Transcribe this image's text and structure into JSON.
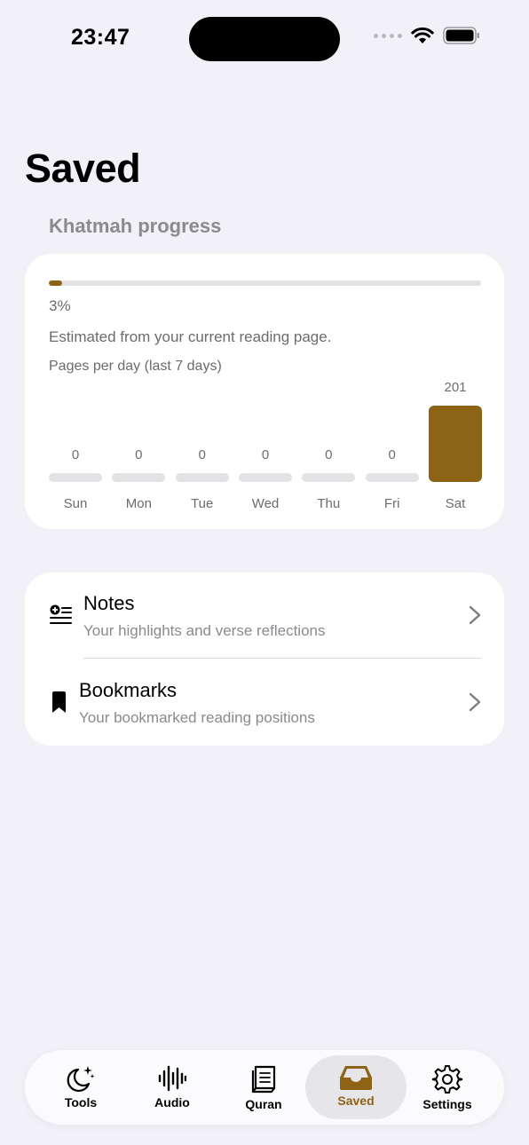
{
  "status_bar": {
    "time": "23:47"
  },
  "page_title": "Saved",
  "khatmah": {
    "section_label": "Khatmah progress",
    "progress_value": 0.03,
    "percent_label": "3%",
    "note": "Estimated from your current reading page.",
    "accent_color": "#8d6416"
  },
  "chart_data": {
    "type": "bar",
    "title": "Pages per day (last 7 days)",
    "categories": [
      "Sun",
      "Mon",
      "Tue",
      "Wed",
      "Thu",
      "Fri",
      "Sat"
    ],
    "values": [
      0,
      0,
      0,
      0,
      0,
      0,
      201
    ],
    "value_labels": [
      "0",
      "0",
      "0",
      "0",
      "0",
      "0",
      "201"
    ]
  },
  "list": {
    "notes": {
      "title": "Notes",
      "subtitle": "Your highlights and verse reflections",
      "icon": "notes-icon"
    },
    "bookmarks": {
      "title": "Bookmarks",
      "subtitle": "Your bookmarked reading positions",
      "icon": "bookmark-icon"
    }
  },
  "tabs": [
    {
      "label": "Tools",
      "icon": "moon-stars-icon"
    },
    {
      "label": "Audio",
      "icon": "waveform-icon"
    },
    {
      "label": "Quran",
      "icon": "book-icon"
    },
    {
      "label": "Saved",
      "icon": "tray-icon",
      "active": true
    },
    {
      "label": "Settings",
      "icon": "gear-icon"
    }
  ]
}
